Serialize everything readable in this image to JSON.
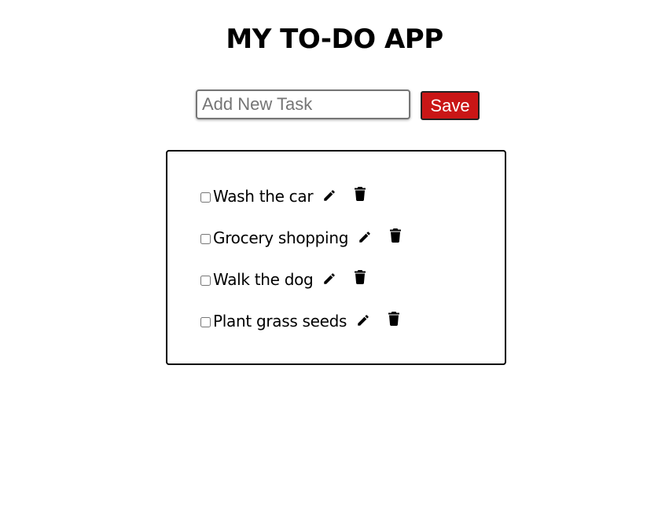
{
  "app": {
    "title": "MY TO-DO APP"
  },
  "form": {
    "input_placeholder": "Add New Task",
    "input_value": "",
    "save_label": "Save",
    "save_color": "#c91616"
  },
  "tasks": [
    {
      "label": "Wash the car",
      "completed": false,
      "edit_icon": "pencil-icon",
      "delete_icon": "trash-icon"
    },
    {
      "label": "Grocery shopping",
      "completed": false,
      "edit_icon": "pencil-icon",
      "delete_icon": "trash-icon"
    },
    {
      "label": "Walk the dog",
      "completed": false,
      "edit_icon": "pencil-icon",
      "delete_icon": "trash-icon"
    },
    {
      "label": "Plant grass seeds",
      "completed": false,
      "edit_icon": "pencil-icon",
      "delete_icon": "trash-icon"
    }
  ]
}
